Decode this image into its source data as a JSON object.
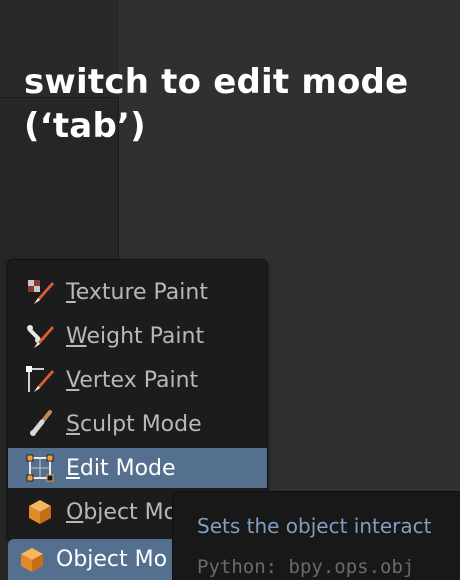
{
  "caption": {
    "line1": "switch to edit mode",
    "line2": "(‘tab’)"
  },
  "mode_menu": {
    "items": [
      {
        "mnemonic": "T",
        "rest": "exture Paint",
        "icon": "texture-paint-icon"
      },
      {
        "mnemonic": "W",
        "rest": "eight Paint",
        "icon": "weight-paint-icon"
      },
      {
        "mnemonic": "V",
        "rest": "ertex Paint",
        "icon": "vertex-paint-icon"
      },
      {
        "mnemonic": "S",
        "rest": "culpt Mode",
        "icon": "sculpt-mode-icon"
      },
      {
        "mnemonic": "E",
        "rest": "dit Mode",
        "icon": "edit-mode-icon",
        "active": true
      },
      {
        "mnemonic": "O",
        "rest": "bject Mo",
        "icon": "object-mode-icon"
      }
    ]
  },
  "mode_button": {
    "label": "Object Mo",
    "icon": "object-mode-icon"
  },
  "tooltip": {
    "description": "Sets the object interact",
    "python": "Python: bpy.ops.obj"
  },
  "colors": {
    "highlight": "#54708e",
    "menu_bg": "#1c1c1c",
    "tooltip_text": "#7f9fc0"
  }
}
